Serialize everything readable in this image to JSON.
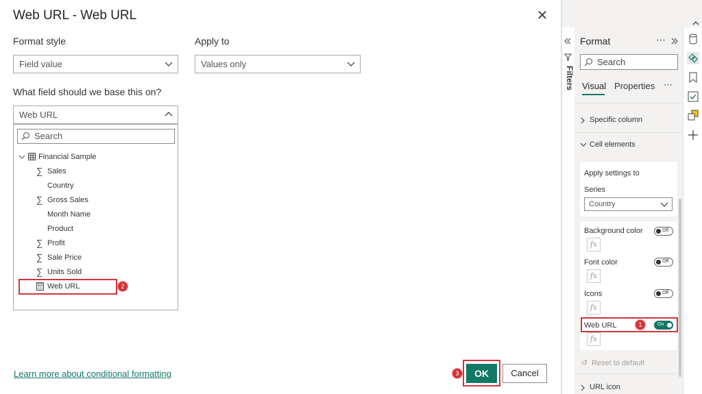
{
  "dialog": {
    "title": "Web URL - Web URL",
    "format_style_label": "Format style",
    "format_style_value": "Field value",
    "apply_to_label": "Apply to",
    "apply_to_value": "Values only",
    "field_question": "What field should we base this on?",
    "field_value": "Web URL",
    "search_placeholder": "Search",
    "tree": {
      "table": "Financial Sample",
      "fields": [
        {
          "name": "Sales",
          "sigma": true
        },
        {
          "name": "Country",
          "sigma": false
        },
        {
          "name": "Gross Sales",
          "sigma": true
        },
        {
          "name": "Month Name",
          "sigma": false
        },
        {
          "name": "Product",
          "sigma": false
        },
        {
          "name": "Profit",
          "sigma": true
        },
        {
          "name": "Sale Price",
          "sigma": true
        },
        {
          "name": "Units Sold",
          "sigma": true
        },
        {
          "name": "Web URL",
          "sigma": false
        }
      ]
    },
    "learn_more": "Learn more about conditional formatting",
    "ok_label": "OK",
    "cancel_label": "Cancel",
    "badges": {
      "web_url_toggle": "1",
      "web_url_field": "2",
      "ok": "3"
    }
  },
  "filters_label": "Filters",
  "format_pane": {
    "title": "Format",
    "search_placeholder": "Search",
    "tabs": [
      "Visual",
      "Properties"
    ],
    "specific_column": "Specific column",
    "cell_elements": "Cell elements",
    "apply_settings_to": "Apply settings to",
    "series_label": "Series",
    "series_value": "Country",
    "background_color": "Background color",
    "font_color": "Font color",
    "icons": "Icons",
    "web_url": "Web URL",
    "off_label": "Off",
    "on_label": "On",
    "fx_label": "fx",
    "reset_default": "Reset to default",
    "url_icon": "URL icon"
  },
  "colors": {
    "accent": "#117865",
    "highlight": "#d13438"
  }
}
